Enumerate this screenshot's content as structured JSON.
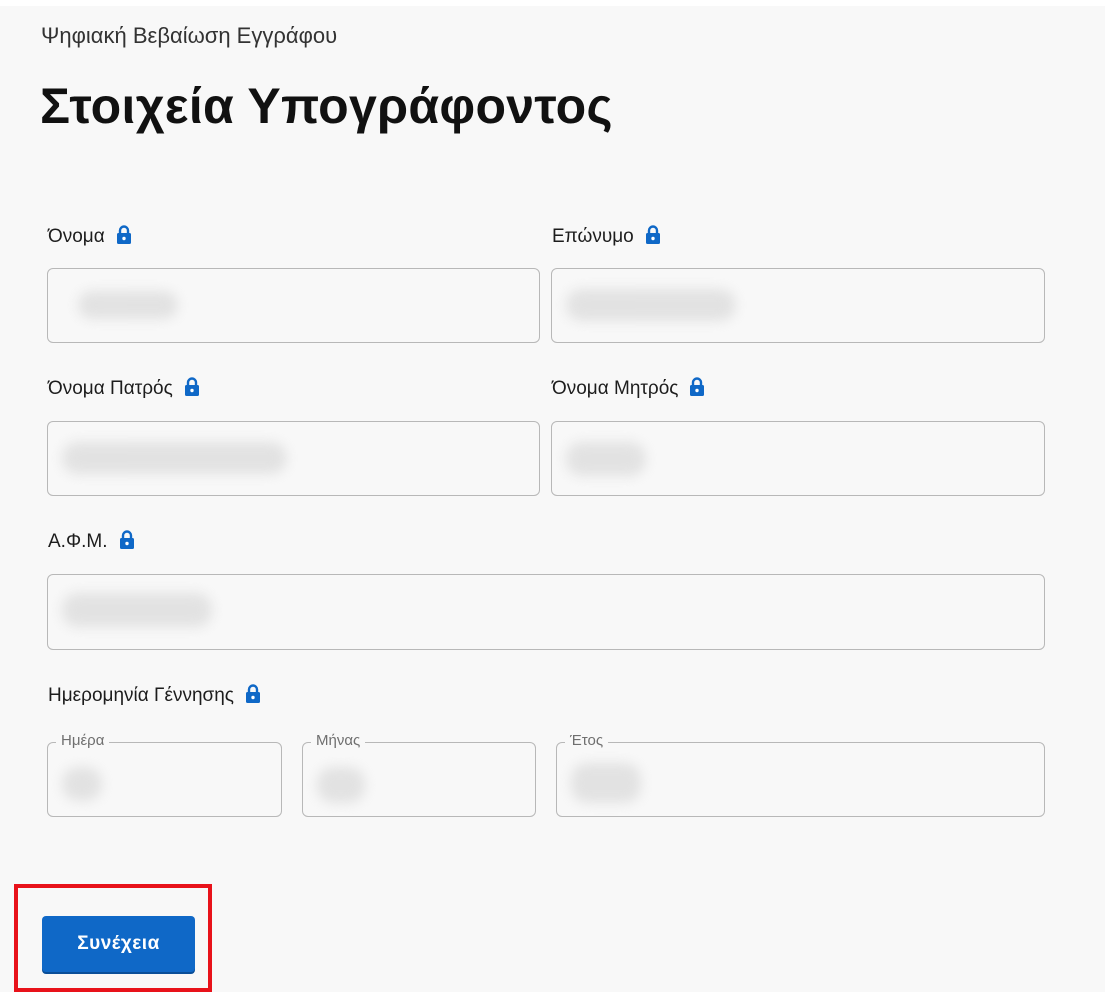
{
  "header": {
    "subtitle": "Ψηφιακή Βεβαίωση Εγγράφου",
    "title": "Στοιχεία Υπογράφοντος"
  },
  "fields": {
    "first_name": {
      "label": "Όνομα",
      "icon": "lock-icon",
      "value": ""
    },
    "last_name": {
      "label": "Επώνυμο",
      "icon": "lock-icon",
      "value": ""
    },
    "father_name": {
      "label": "Όνομα Πατρός",
      "icon": "lock-icon",
      "value": ""
    },
    "mother_name": {
      "label": "Όνομα Μητρός",
      "icon": "lock-icon",
      "value": ""
    },
    "tax_id": {
      "label": "Α.Φ.Μ.",
      "icon": "lock-icon",
      "value": ""
    },
    "birth_date": {
      "label": "Ημερομηνία Γέννησης",
      "icon": "lock-icon",
      "day_label": "Ημέρα",
      "month_label": "Μήνας",
      "year_label": "Έτος"
    }
  },
  "actions": {
    "continue_label": "Συνέχεια"
  },
  "colors": {
    "accent": "#0f68c7",
    "highlight": "#e8121a",
    "background": "#f8f8f8"
  }
}
